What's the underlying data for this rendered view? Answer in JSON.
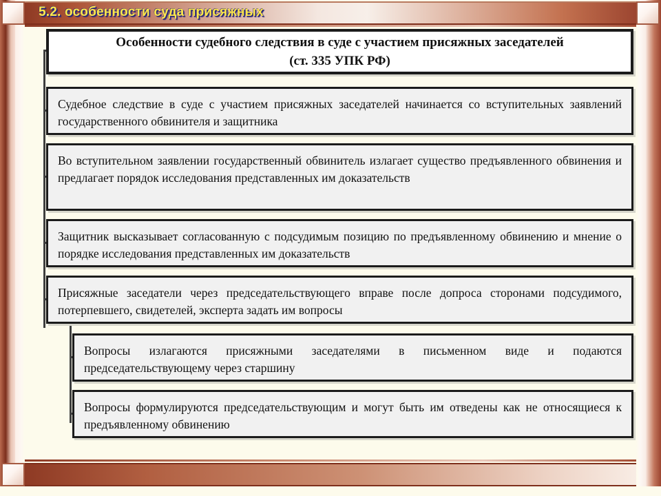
{
  "slide": {
    "header_title": "5.2. особенности суда присяжных",
    "accent_dark": "#8e3a24",
    "accent_light": "#f4e7e0",
    "title_text_color": "#ffe84a",
    "title_shadow_color": "#2a2a7a",
    "page_background": "#fdfbec",
    "node_fill": "#f1f1f1",
    "node_border": "#1b1b1b"
  },
  "diagram": {
    "title_box": {
      "line1": "Особенности судебного следствия в суде с участием присяжных заседателей",
      "line2": "(ст. 335 УПК РФ)"
    },
    "nodes": [
      {
        "id": "node-1",
        "level": 1,
        "text": "Судебное следствие в суде с участием присяжных заседателей начинается со вступительных заявлений государственного обвинителя и защитника"
      },
      {
        "id": "node-2",
        "level": 1,
        "text": "Во вступительном заявлении государственный обвинитель излагает существо предъявленного обвинения и предлагает порядок исследования представленных им доказательств"
      },
      {
        "id": "node-3",
        "level": 1,
        "text": "Защитник высказывает согласованную с подсудимым позицию по предъявленному обвинению и мнение о порядке исследования представленных им доказательств"
      },
      {
        "id": "node-4",
        "level": 1,
        "text": "Присяжные заседатели через председательствующего вправе после допроса сторонами подсудимого, потерпевшего, свидетелей, эксперта задать им вопросы"
      },
      {
        "id": "node-4a",
        "level": 2,
        "text": "Вопросы излагаются присяжными заседателями в письменном виде и подаются председательствующему через старшину"
      },
      {
        "id": "node-4b",
        "level": 2,
        "text": "Вопросы формулируются председательствующим и могут быть им отведены как не относящиеся к предъявленному обвинению"
      }
    ]
  }
}
